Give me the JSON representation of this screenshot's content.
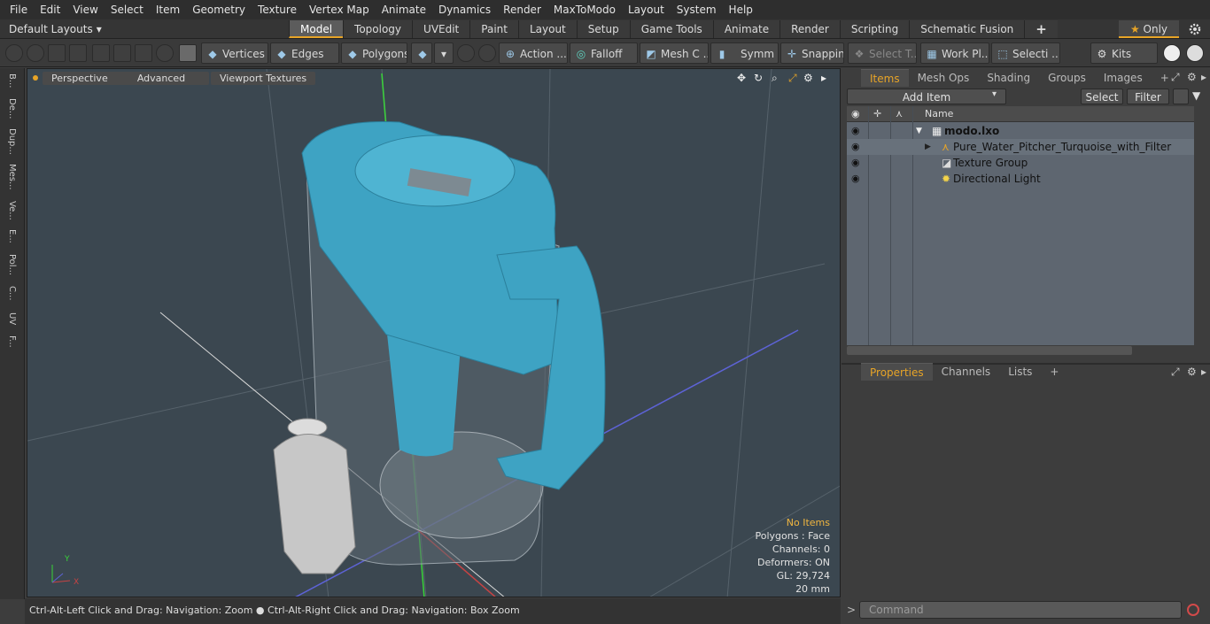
{
  "menubar": {
    "items": [
      "File",
      "Edit",
      "View",
      "Select",
      "Item",
      "Geometry",
      "Texture",
      "Vertex Map",
      "Animate",
      "Dynamics",
      "Render",
      "MaxToModo",
      "Layout",
      "System",
      "Help"
    ]
  },
  "tabbar": {
    "layout": "Default Layouts",
    "layout_caret": "▾",
    "tabs": [
      "Model",
      "Topology",
      "UVEdit",
      "Paint",
      "Layout",
      "Setup",
      "Game Tools",
      "Animate",
      "Render",
      "Scripting",
      "Schematic Fusion"
    ],
    "active_tab": "Model",
    "add_label": "+",
    "only_label": "Only",
    "star": "★",
    "settings_icon": "gear-icon"
  },
  "toolbar": {
    "vertices": "Vertices",
    "edges": "Edges",
    "polygons": "Polygons",
    "action": "Action",
    "falloff": "Falloff",
    "mesh_c": "Mesh C ...",
    "symm": "Symm ...",
    "snapping": "Snapping",
    "select_t": "Select T...",
    "work_pl": "Work Pl...",
    "selecti": "Selecti ...",
    "kits": "Kits",
    "dots": "...",
    "caret": "▾"
  },
  "left_tabs": [
    "B...",
    "De...",
    "Dup...",
    "Mes...",
    "Ve...",
    "E...",
    "Pol...",
    "C...",
    "UV",
    "F..."
  ],
  "viewport": {
    "perspective": "Perspective",
    "advanced": "Advanced",
    "viewport_textures": "Viewport Textures",
    "stats": {
      "no_items": "No Items",
      "polygons": "Polygons : Face",
      "channels": "Channels: 0",
      "deformers": "Deformers: ON",
      "gl": "GL: 29,724",
      "size": "20 mm"
    },
    "axis_x": "X",
    "axis_y": "Y"
  },
  "status": {
    "hint1": "Ctrl-Alt-Left Click and Drag: Navigation: Zoom",
    "bullet": "●",
    "hint2": "Ctrl-Alt-Right Click and Drag: Navigation: Box Zoom"
  },
  "items_panel": {
    "tabs": [
      "Items",
      "Mesh Ops",
      "Shading",
      "Groups",
      "Images"
    ],
    "active": "Items",
    "plus": "+",
    "add_item": "Add Item",
    "select": "Select",
    "filter": "Filter",
    "name_header": "Name",
    "tree": [
      {
        "label": "modo.lxo",
        "level": 0,
        "expand": "▼"
      },
      {
        "label": "Pure_Water_Pitcher_Turquoise_with_Filter",
        "level": 1,
        "expand": "▶"
      },
      {
        "label": "Texture Group",
        "level": 1,
        "expand": ""
      },
      {
        "label": "Directional Light",
        "level": 1,
        "expand": ""
      }
    ]
  },
  "properties_panel": {
    "tabs": [
      "Properties",
      "Channels",
      "Lists"
    ],
    "active": "Properties",
    "plus": "+"
  },
  "command": {
    "placeholder": "Command",
    "prompt": ">"
  },
  "colors": {
    "accent": "#e7a427",
    "pitcher": "#3ea3c3",
    "viewport_bg": "#3b4750"
  }
}
